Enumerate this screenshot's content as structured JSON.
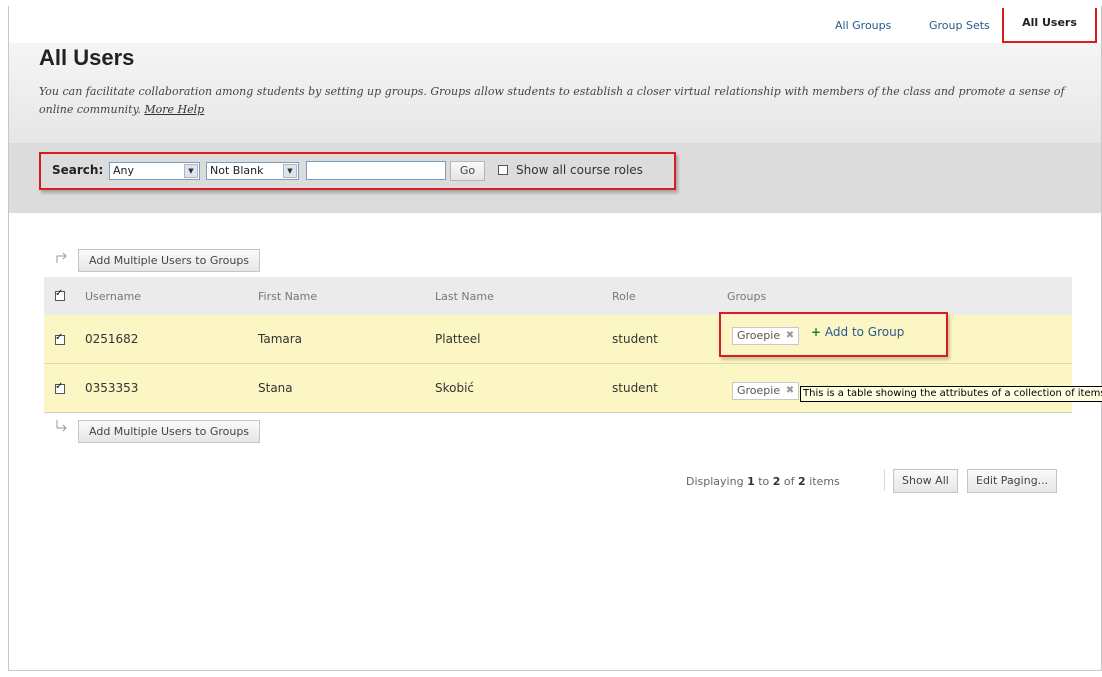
{
  "topnav": {
    "links": [
      "All Groups",
      "Group Sets"
    ],
    "active": "All Users"
  },
  "header": {
    "title": "All Users",
    "description": "You can facilitate collaboration among students by setting up groups. Groups allow students to establish a closer virtual relationship with members of the class and promote a sense of online community.",
    "help_link": "More Help"
  },
  "search": {
    "label": "Search:",
    "field_select": "Any",
    "operator_select": "Not Blank",
    "query_value": "",
    "go_label": "Go",
    "show_roles_label": "Show all course roles"
  },
  "actions": {
    "add_multiple_label": "Add Multiple Users to Groups"
  },
  "table": {
    "columns": [
      "Username",
      "First Name",
      "Last Name",
      "Role",
      "Groups"
    ],
    "rows": [
      {
        "username": "0251682",
        "first": "Tamara",
        "last": "Platteel",
        "role": "student",
        "group": "Groepie",
        "add_label": "Add to Group"
      },
      {
        "username": "0353353",
        "first": "Stana",
        "last": "Skobić",
        "role": "student",
        "group": "Groepie"
      }
    ]
  },
  "tooltip": "This is a table showing the attributes of a collection of items",
  "paging": {
    "prefix": "Displaying",
    "start": "1",
    "to": "to",
    "end": "2",
    "of": "of",
    "total": "2",
    "suffix": "items",
    "show_all_label": "Show All",
    "edit_paging_label": "Edit Paging..."
  },
  "colors": {
    "highlight_red": "#d71d1d",
    "row_yellow": "#fcf6c4",
    "link_blue": "#2a5a8f"
  }
}
